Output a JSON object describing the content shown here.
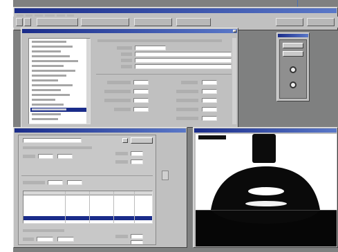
{
  "app": {
    "title": "",
    "menu": [],
    "toolbar": []
  },
  "data_window": {
    "title": "",
    "list_items": [],
    "selected_index": null,
    "fields": []
  },
  "control_palette": {
    "title": ""
  },
  "measurement_window": {
    "title": "",
    "fields": [],
    "table": {
      "columns": [],
      "rows": []
    }
  },
  "video_window": {
    "title": "",
    "readout": ""
  },
  "colors": {
    "titlebar": "#1a2c8a",
    "window_face": "#c0c0c0",
    "selection": "#1a2c8a",
    "desktop": "#7f8080"
  }
}
